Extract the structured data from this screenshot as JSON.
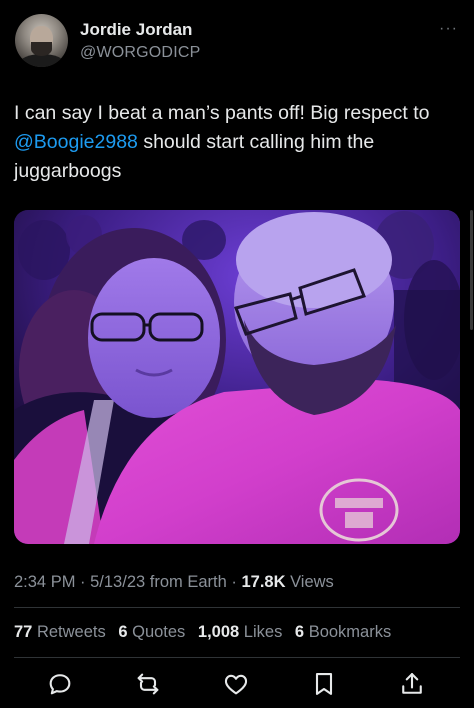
{
  "author": {
    "display_name": "Jordie Jordan",
    "handle": "@WORGODICP"
  },
  "more_label": "···",
  "tweet": {
    "text_before": "I can say I beat a man’s pants off! Big respect to ",
    "mention": "@Boogie2988",
    "text_after": " should start calling him the juggarboogs"
  },
  "meta": {
    "time": "2:34 PM",
    "sep1": " · ",
    "date": "5/13/23",
    "source": " from Earth",
    "sep2": " · ",
    "views_count": "17.8K",
    "views_label": " Views"
  },
  "stats": {
    "retweets_count": "77",
    "retweets_label": "Retweets",
    "quotes_count": "6",
    "quotes_label": "Quotes",
    "likes_count": "1,008",
    "likes_label": "Likes",
    "bookmarks_count": "6",
    "bookmarks_label": "Bookmarks"
  },
  "icons": {
    "reply": "reply-icon",
    "retweet": "retweet-icon",
    "like": "like-icon",
    "bookmark": "bookmark-icon",
    "share": "share-icon"
  },
  "colors": {
    "background": "#000000",
    "text": "#e7e9ea",
    "secondary": "#8b9199",
    "mention": "#1d9bf0",
    "divider": "#2f3336"
  }
}
